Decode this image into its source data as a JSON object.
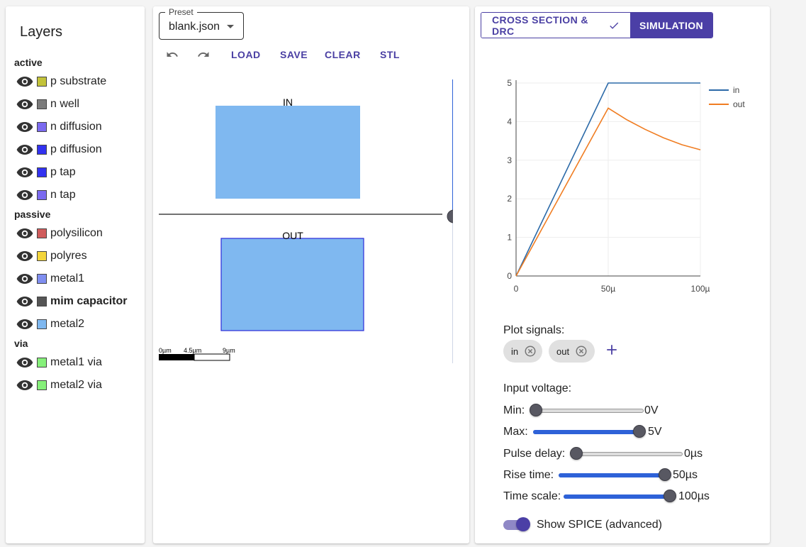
{
  "layers": {
    "title": "Layers",
    "groups": [
      {
        "label": "active",
        "items": [
          {
            "name": "p substrate",
            "color": "#c3c33a",
            "bold": false
          },
          {
            "name": "n well",
            "color": "#7c7c7c",
            "bold": false
          },
          {
            "name": "n diffusion",
            "color": "#7b6af0",
            "bold": false
          },
          {
            "name": "p diffusion",
            "color": "#3232f0",
            "bold": false
          },
          {
            "name": "p tap",
            "color": "#3232f0",
            "bold": false
          },
          {
            "name": "n tap",
            "color": "#7b6af0",
            "bold": false
          }
        ]
      },
      {
        "label": "passive",
        "items": [
          {
            "name": "polysilicon",
            "color": "#d05c5c",
            "bold": false
          },
          {
            "name": "polyres",
            "color": "#f3d53b",
            "bold": false
          },
          {
            "name": "metal1",
            "color": "#7f8ef0",
            "bold": false
          },
          {
            "name": "mim capacitor",
            "color": "#555555",
            "bold": true
          },
          {
            "name": "metal2",
            "color": "#7fb8f0",
            "bold": false
          }
        ]
      },
      {
        "label": "via",
        "items": [
          {
            "name": "metal1 via",
            "color": "#86f07a",
            "bold": false
          },
          {
            "name": "metal2 via",
            "color": "#86f07a",
            "bold": false
          }
        ]
      }
    ]
  },
  "editor": {
    "preset_label": "Preset",
    "preset_value": "blank.json",
    "toolbar": {
      "load": "LOAD",
      "save": "SAVE",
      "clear": "CLEAR",
      "stl": "STL"
    },
    "canvas": {
      "top_label": "IN",
      "bottom_label": "OUT",
      "scale_labels": [
        "0µm",
        "4.5µm",
        "9µm"
      ],
      "metal_color": "#7fb8f0"
    }
  },
  "simulation": {
    "tabs": {
      "cross_section": "CROSS SECTION & DRC",
      "simulation": "SIMULATION",
      "active": "simulation"
    },
    "plot_signals_label": "Plot signals:",
    "signals": [
      "in",
      "out"
    ],
    "input_voltage_label": "Input voltage:",
    "sliders": [
      {
        "label": "Min:",
        "value_text": "0V",
        "fraction": 0.0
      },
      {
        "label": "Max:",
        "value_text": "5V",
        "fraction": 1.0
      },
      {
        "label": "Pulse delay:",
        "value_text": "0µs",
        "fraction": 0.0
      },
      {
        "label": "Rise time:",
        "value_text": "50µs",
        "fraction": 1.0
      },
      {
        "label": "Time scale:",
        "value_text": "100µs",
        "fraction": 1.0
      }
    ],
    "spice_toggle": {
      "label": "Show SPICE (advanced)",
      "on": true
    }
  },
  "chart_data": {
    "type": "line",
    "x_tick_labels": [
      "0",
      "50µ",
      "100µ"
    ],
    "y_ticks": [
      0,
      1,
      2,
      3,
      4,
      5
    ],
    "xlim": [
      0,
      0.0001
    ],
    "ylim": [
      0,
      5
    ],
    "grid": true,
    "legend_position": "top-right",
    "series": [
      {
        "name": "in",
        "color": "#2c6aa8",
        "points": [
          [
            0,
            0
          ],
          [
            5e-05,
            5
          ],
          [
            0.0001,
            5
          ]
        ]
      },
      {
        "name": "out",
        "color": "#f07d22",
        "points": [
          [
            0,
            0
          ],
          [
            5e-05,
            4.35
          ],
          [
            6e-05,
            4.05
          ],
          [
            7e-05,
            3.8
          ],
          [
            8e-05,
            3.58
          ],
          [
            9e-05,
            3.4
          ],
          [
            0.0001,
            3.27
          ]
        ]
      }
    ]
  }
}
